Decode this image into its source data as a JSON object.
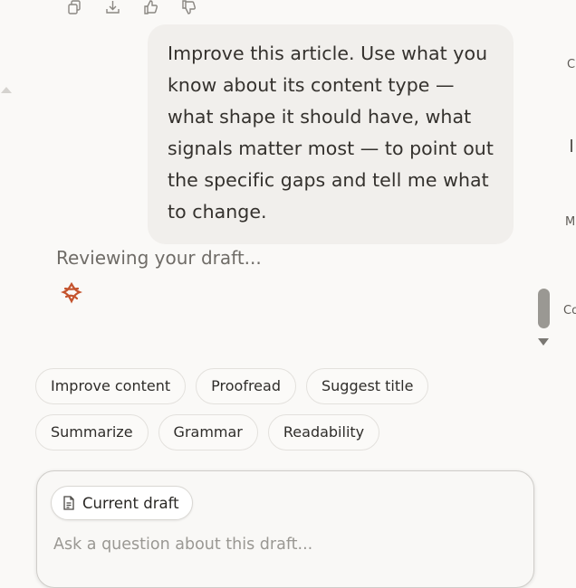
{
  "toolbar": {
    "icons": [
      "copy-icon",
      "download-icon",
      "thumbs-up-icon",
      "thumbs-down-icon"
    ]
  },
  "conversation": {
    "user_message": "Improve this article. Use what you know about its content type — what shape it should have, what signals matter most — to point out the specific gaps and tell me what to change.",
    "status_text": "Reviewing your draft..."
  },
  "right_panel": {
    "clipped_letters": [
      "C",
      "M",
      "Co"
    ]
  },
  "suggestions": {
    "row1": [
      "Improve content",
      "Proofread",
      "Suggest title"
    ],
    "row2": [
      "Summarize",
      "Grammar",
      "Readability"
    ]
  },
  "composer": {
    "attachment_label": "Current draft",
    "placeholder": "Ask a question about this draft..."
  },
  "colors": {
    "background": "#faf9f7",
    "bubble": "#f1efec",
    "spinner": "#c4532d"
  }
}
